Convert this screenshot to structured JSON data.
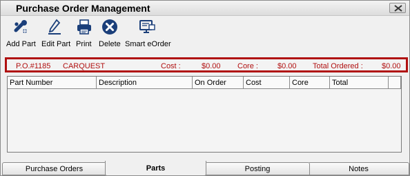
{
  "window": {
    "title": "Purchase Order Management"
  },
  "toolbar": {
    "add_part": "Add Part",
    "edit_part": "Edit Part",
    "print": "Print",
    "delete": "Delete",
    "smart_eorder": "Smart eOrder"
  },
  "po_summary": {
    "po_number": "P.O.#1185",
    "vendor": "CARQUEST",
    "cost_label": "Cost :",
    "cost_value": "$0.00",
    "core_label": "Core :",
    "core_value": "$0.00",
    "total_label": "Total Ordered :",
    "total_value": "$0.00"
  },
  "grid": {
    "columns": [
      "Part Number",
      "Description",
      "On Order",
      "Cost",
      "Core",
      "Total",
      ""
    ],
    "rows": []
  },
  "tabs": [
    {
      "label": "Purchase Orders",
      "active": false
    },
    {
      "label": "Parts",
      "active": true
    },
    {
      "label": "Posting",
      "active": false
    },
    {
      "label": "Notes",
      "active": false
    }
  ],
  "colors": {
    "accent_red": "#b01010",
    "icon_blue": "#1b3f7a"
  }
}
